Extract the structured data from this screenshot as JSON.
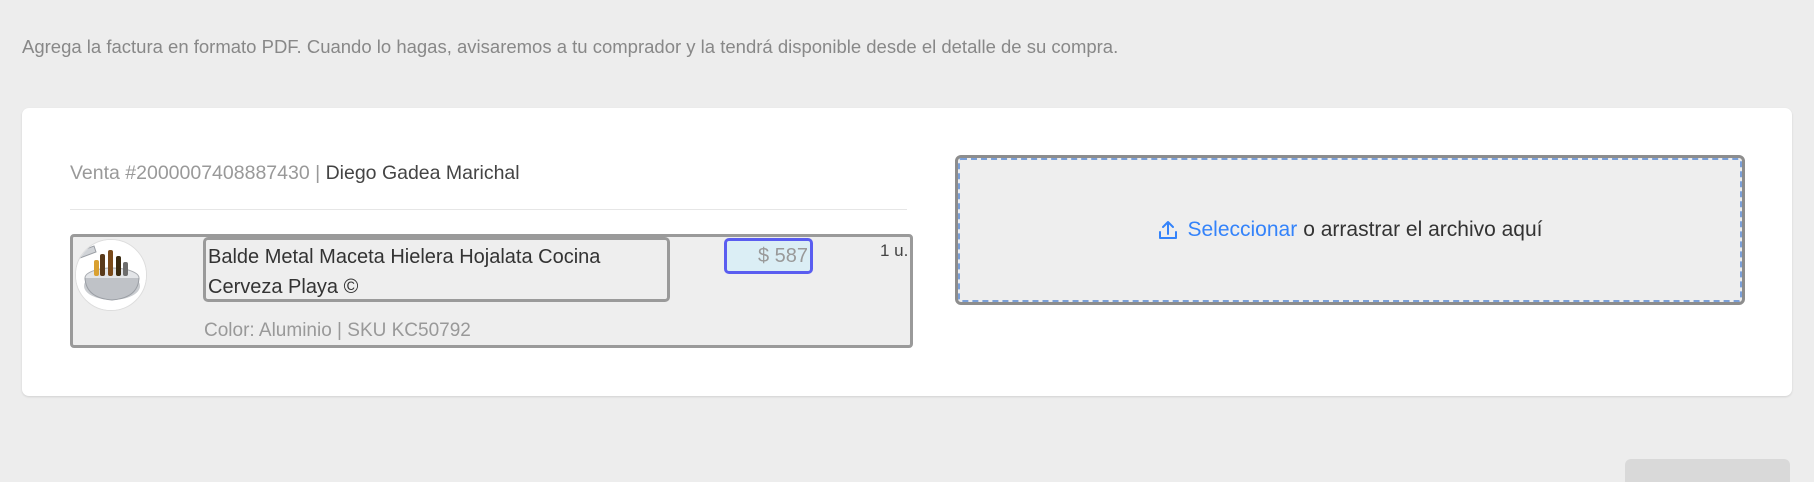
{
  "instruction": "Agrega la factura en formato PDF. Cuando lo hagas, avisaremos a tu comprador y la tendrá disponible desde el detalle de su compra.",
  "order": {
    "sale_label": "Venta #2000007408887430",
    "separator": " | ",
    "buyer_name": "Diego Gadea Marichal"
  },
  "product": {
    "title": "Balde Metal Maceta Hielera Hojalata Cocina Cerveza Playa ©",
    "price": "$ 587",
    "quantity": "1 u.",
    "attributes": "Color: Aluminio | SKU KC50792"
  },
  "upload": {
    "icon": "upload-icon",
    "select_label": "Seleccionar",
    "drop_text": "o arrastrar el archivo aquí"
  },
  "colors": {
    "link": "#3483fa",
    "price_highlight_border": "#5a5df0",
    "dropzone_dash": "#7a9fd8"
  }
}
